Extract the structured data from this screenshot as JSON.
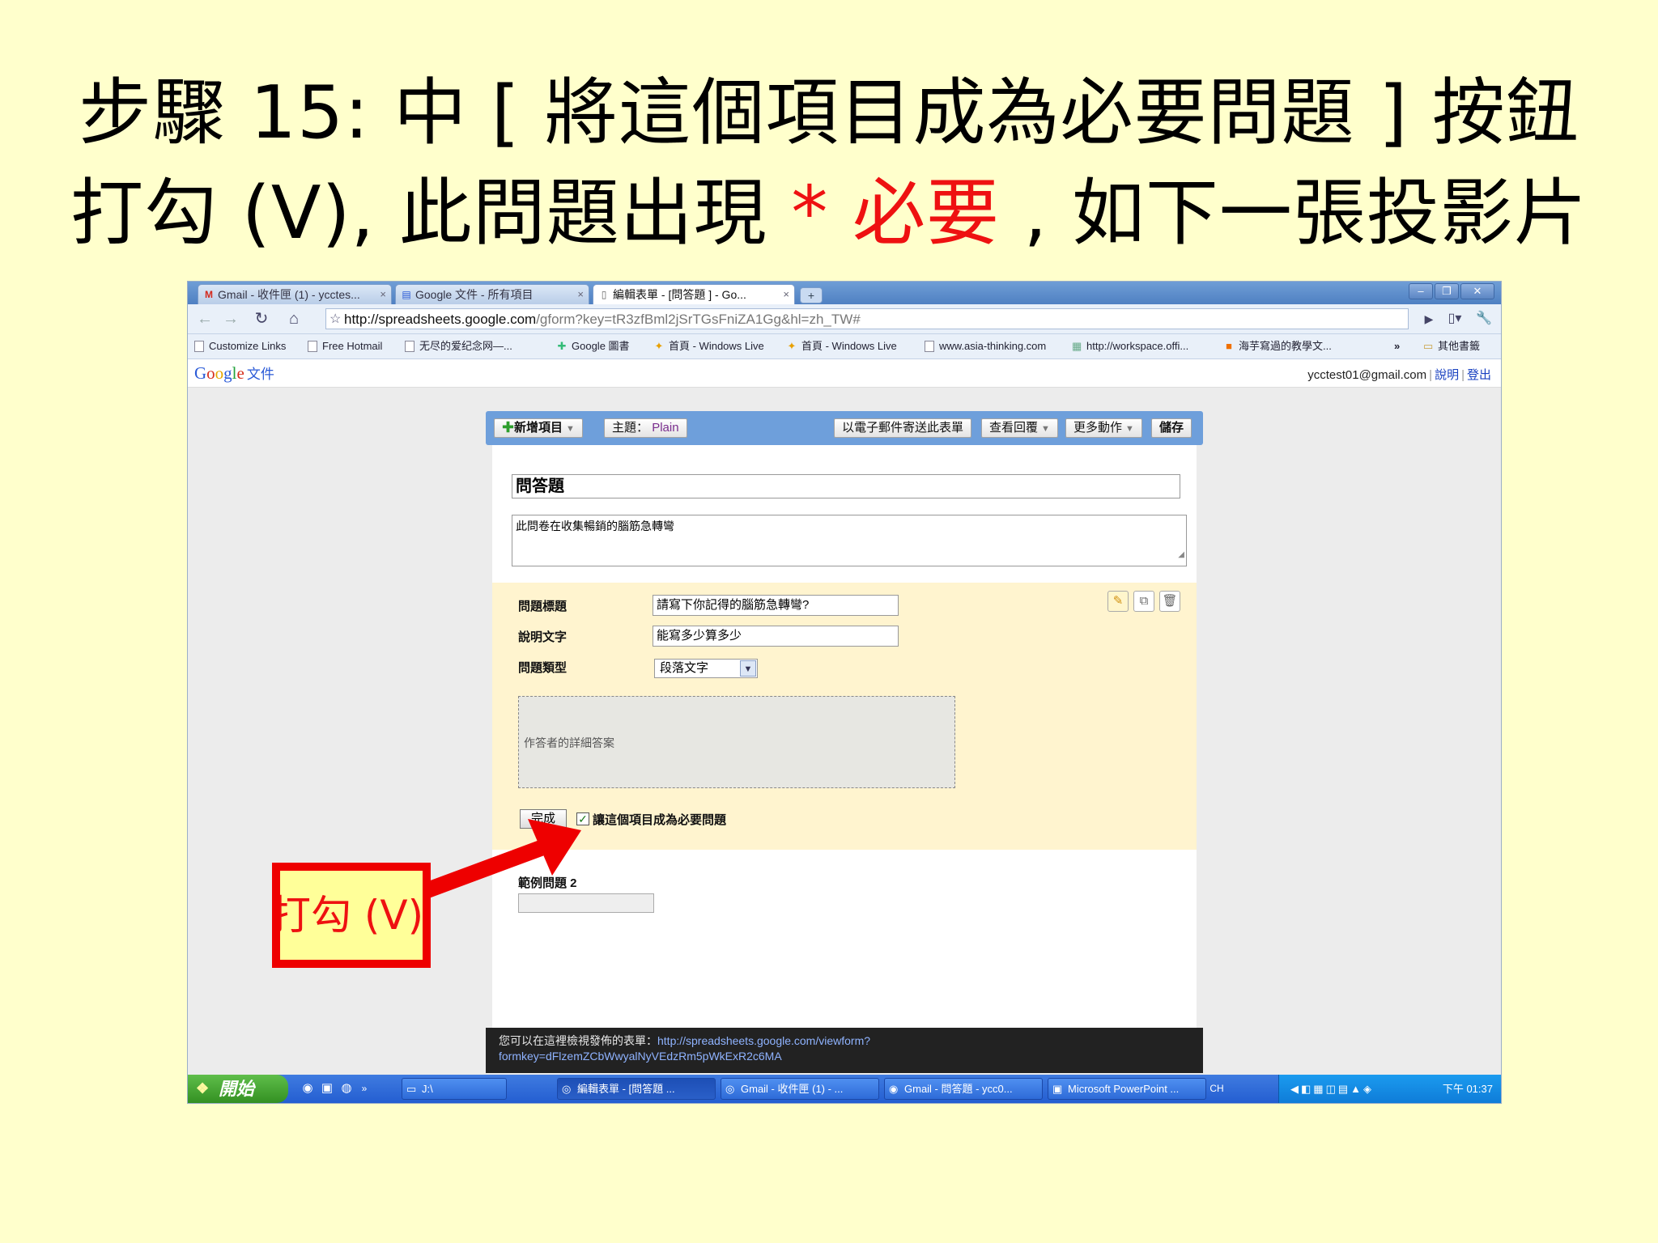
{
  "slide": {
    "title_line1": "步驟 15: 中 [ 將這個項目成為必要問題 ] 按鈕",
    "title_line2_a": "打勾 (V), 此問題出現 ",
    "title_line2_red": "* 必要",
    "title_line2_b": " , 如下一張投影片",
    "callout": "打勾 (V)"
  },
  "browser": {
    "tabs": [
      {
        "label": "Gmail - 收件匣 (1) - ycctes...",
        "icon": "M"
      },
      {
        "label": "Google 文件 - 所有項目",
        "icon": "▤"
      },
      {
        "label": "編輯表單 - [問答題 ] - Go...",
        "icon": "▯"
      }
    ],
    "new_tab": "+",
    "url_host": "http://spreadsheets.google.com",
    "url_rest": "/gform?key=tR3zfBml2jSrTGsFniZA1Gg&hl=zh_TW#",
    "bookmarks": [
      "Customize Links",
      "Free Hotmail",
      "无尽的爱纪念网—...",
      "Google 圖書",
      "首頁 - Windows Live",
      "首頁 - Windows Live",
      "www.asia-thinking.com",
      "http://workspace.offi...",
      "海芋寫過的教學文..."
    ],
    "bookmarks_more": "»",
    "other_bookmarks": "其他書籤"
  },
  "gdocs": {
    "logo_letters": [
      "G",
      "o",
      "o",
      "g",
      "l",
      "e"
    ],
    "logo_suffix": "文件",
    "account_email": "ycctest01@gmail.com",
    "help": "說明",
    "signout": "登出",
    "sep": "|"
  },
  "form_toolbar": {
    "add_item": "新增項目",
    "theme_label": "主題：",
    "theme_value": "Plain",
    "email_form": "以電子郵件寄送此表單",
    "see_responses": "查看回覆",
    "more_actions": "更多動作",
    "save": "儲存",
    "dropdown_arrow": "▼"
  },
  "form": {
    "title": "問答題",
    "description": "此問卷在收集暢銷的腦筋急轉彎",
    "question_title_label": "問題標題",
    "question_title_value": "請寫下你記得的腦筋急轉彎?",
    "help_text_label": "說明文字",
    "help_text_value": "能寫多少算多少",
    "question_type_label": "問題類型",
    "question_type_value": "段落文字",
    "answer_placeholder": "作答者的詳細答案",
    "done_button": "完成",
    "required_checked": "✓",
    "required_label": "讓這個項目成為必要問題",
    "sample_question": "範例問題 2"
  },
  "view_bar": {
    "text": "您可以在這裡檢視發佈的表單：",
    "link_line1": "http://spreadsheets.google.com/viewform?",
    "link_line2": "formkey=dFlzemZCbWwyalNyVEdzRm5pWkExR2c6MA"
  },
  "taskbar": {
    "start": "開始",
    "folder": "J:\\",
    "items": [
      "編輯表單 - [問答題 ...",
      "Gmail - 收件匣 (1) - ...",
      "Gmail - 問答題 - ycc0...",
      "Microsoft PowerPoint ..."
    ],
    "lang": "CH",
    "clock": "下午 01:37"
  },
  "colors": {
    "slide_bg": "#ffffcc",
    "highlight_red": "#ee1111",
    "toolbar_blue": "#6e9fdb",
    "question_bg": "#fff4cf"
  }
}
